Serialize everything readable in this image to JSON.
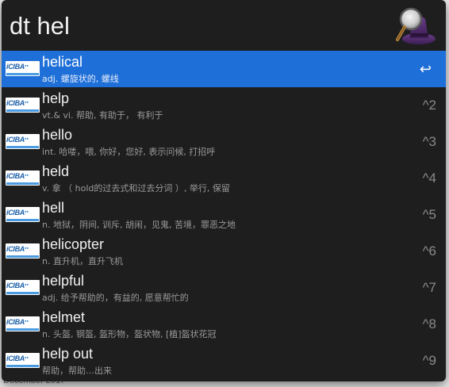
{
  "backdrop": {
    "footer_text": "December 2017"
  },
  "launcher": {
    "query": "dt hel",
    "icon": "alfred-hat-icon",
    "colors": {
      "background": "#1e1e1f",
      "selection": "#1f6fd8"
    },
    "results_icon_label": "iCIBA",
    "results": [
      {
        "title": "helical",
        "subtitle": "adj. 螺旋状的, 螺线",
        "shortcut": "↩",
        "selected": true
      },
      {
        "title": "help",
        "subtitle": "vt.& vi. 帮助, 有助于，  有利于",
        "shortcut": "^2",
        "selected": false
      },
      {
        "title": "hello",
        "subtitle": "int. 哈喽，喂, 你好，您好, 表示问候, 打招呼",
        "shortcut": "^3",
        "selected": false
      },
      {
        "title": "held",
        "subtitle": "v. 拿 （ hold的过去式和过去分词 ）, 举行, 保留",
        "shortcut": "^4",
        "selected": false
      },
      {
        "title": "hell",
        "subtitle": "n. 地狱，阴间, 训斥, 胡闹，见鬼, 苦境，罪恶之地",
        "shortcut": "^5",
        "selected": false
      },
      {
        "title": "helicopter",
        "subtitle": "n. 直升机，直升飞机",
        "shortcut": "^6",
        "selected": false
      },
      {
        "title": "helpful",
        "subtitle": "adj. 给予帮助的，有益的, 愿意帮忙的",
        "shortcut": "^7",
        "selected": false
      },
      {
        "title": "helmet",
        "subtitle": "n. 头盔, 钢盔, 盔形物，盔状物, [植]盔状花冠",
        "shortcut": "^8",
        "selected": false
      },
      {
        "title": "help out",
        "subtitle": " 帮助，帮助…出来",
        "shortcut": "^9",
        "selected": false
      }
    ]
  }
}
